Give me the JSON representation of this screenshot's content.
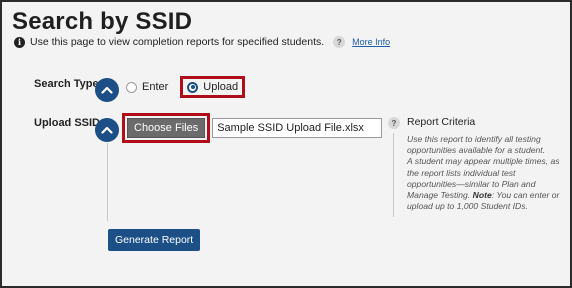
{
  "page": {
    "title": "Search by SSID",
    "subtitle": "Use this page to view completion reports for specified students.",
    "more_info": "More Info"
  },
  "search_type": {
    "label": "Search Type",
    "options": [
      {
        "label": "Enter",
        "selected": false
      },
      {
        "label": "Upload",
        "selected": true
      }
    ]
  },
  "upload": {
    "label": "Upload SSID",
    "choose_files_label": "Choose Files",
    "file_name": "Sample SSID Upload File.xlsx"
  },
  "criteria": {
    "title": "Report Criteria",
    "p1": "Use this report to identify all testing opportunities available for a student.",
    "p2": "A student may appear multiple times, as the report lists individual test opportunities—similar to Plan and Manage Testing.",
    "note_label": "Note",
    "note_text": ": You can enter or upload up to 1,000 Student IDs."
  },
  "actions": {
    "generate_report": "Generate Report"
  },
  "colors": {
    "primary": "#1b4f86",
    "highlight": "#b00d1a",
    "link": "#1f5ea8"
  }
}
